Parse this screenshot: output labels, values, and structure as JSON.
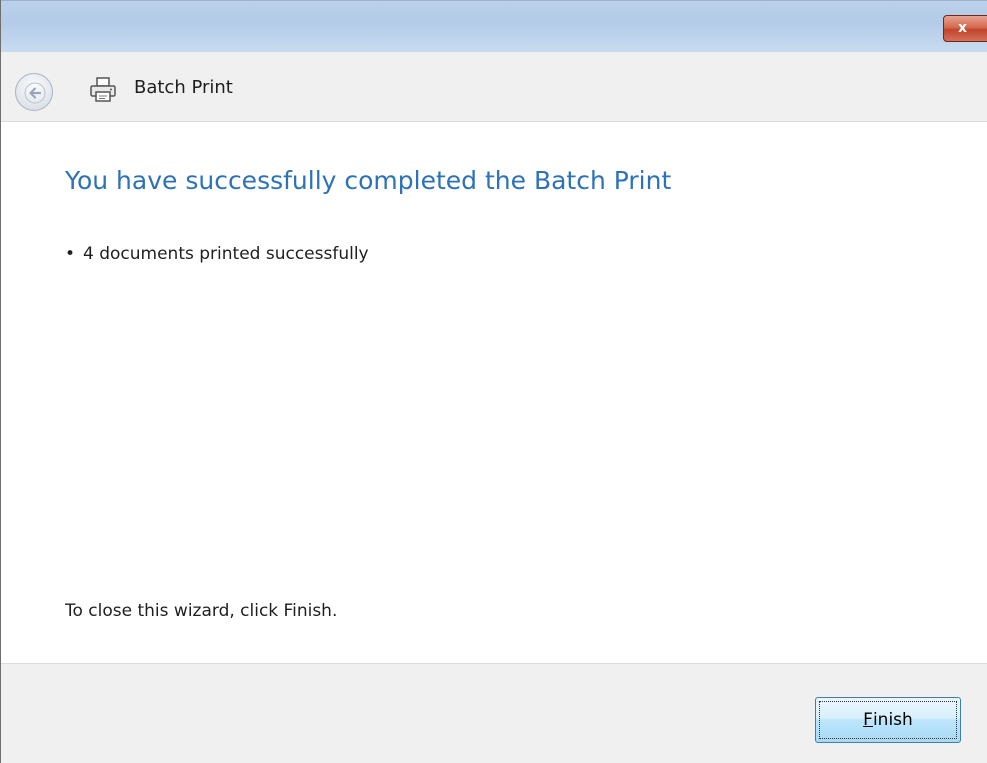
{
  "window": {
    "close_label": "x"
  },
  "header": {
    "title": "Batch Print",
    "back_icon": "back-arrow-icon",
    "app_icon": "printer-icon"
  },
  "main": {
    "heading": "You have successfully completed the Batch Print",
    "results": [
      {
        "bullet": "•",
        "text": "4 documents printed successfully"
      }
    ],
    "close_instruction": "To close this wizard, click Finish."
  },
  "footer": {
    "finish_mnemonic": "F",
    "finish_rest": "inish"
  },
  "colors": {
    "heading": "#2d72b7",
    "titlebar": "#bcd1ea",
    "close_button": "#c1452b",
    "chrome": "#f0f0f0"
  }
}
